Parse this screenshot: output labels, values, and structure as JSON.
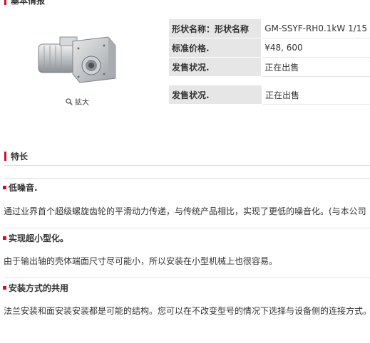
{
  "sections": {
    "basic_title": "基本情报",
    "features_title": "特长"
  },
  "product": {
    "zoom_label": "拡大"
  },
  "spec_rows": [
    {
      "label": "形状名称：形状名称",
      "value": "GM-SSYF-RH0.1kW 1/15"
    },
    {
      "label": "标准价格.",
      "value": "¥48, 600"
    },
    {
      "label": "发售状况.",
      "value": "正在出售"
    }
  ],
  "spec_rows_2": [
    {
      "label": "发售状况.",
      "value": "正在出售"
    }
  ],
  "features": [
    {
      "title": "低噪音.",
      "text": "通过业界首个超级螺旋齿轮的平滑动力传递，与传统产品相比，实现了更低的噪音化。(与本公司"
    },
    {
      "title": "实现超小型化。",
      "text": "由于输出轴的壳体端面尺寸尽可能小，所以安装在小型机械上也很容易。"
    },
    {
      "title": "安装方式的共用",
      "text": "法兰安装和面安装安装都是可能的结构。您可以在不改变型号的情况下选择与设备侧的连接方式。"
    }
  ],
  "colors": {
    "accent": "#c8102e",
    "table_header_bg": "#e6e6e6"
  },
  "icons": {
    "zoom": "magnifier-icon"
  }
}
